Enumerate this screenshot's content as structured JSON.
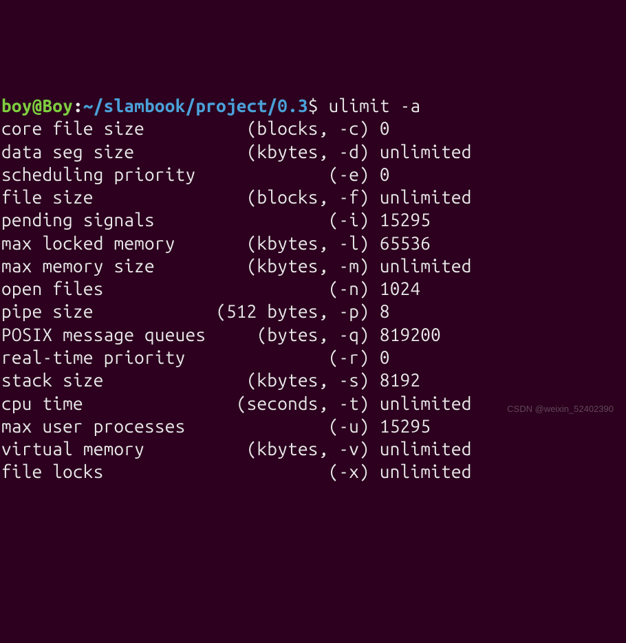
{
  "prompt": {
    "user": "boy@Boy",
    "colon": ":",
    "path": "~/slambook/project/0.3",
    "dollar": "$ ",
    "command": "ulimit -a"
  },
  "rows": [
    {
      "name": "core file size          ",
      "spec": "(blocks, -c) ",
      "val": "0"
    },
    {
      "name": "data seg size           ",
      "spec": "(kbytes, -d) ",
      "val": "unlimited"
    },
    {
      "name": "scheduling priority     ",
      "spec": "        (-e) ",
      "val": "0"
    },
    {
      "name": "file size               ",
      "spec": "(blocks, -f) ",
      "val": "unlimited"
    },
    {
      "name": "pending signals         ",
      "spec": "        (-i) ",
      "val": "15295"
    },
    {
      "name": "max locked memory       ",
      "spec": "(kbytes, -l) ",
      "val": "65536"
    },
    {
      "name": "max memory size         ",
      "spec": "(kbytes, -m) ",
      "val": "unlimited"
    },
    {
      "name": "open files              ",
      "spec": "        (-n) ",
      "val": "1024"
    },
    {
      "name": "pipe size            ",
      "spec": "(512 bytes, -p) ",
      "val": "8"
    },
    {
      "name": "POSIX message queues     ",
      "spec": "(bytes, -q) ",
      "val": "819200"
    },
    {
      "name": "real-time priority      ",
      "spec": "        (-r) ",
      "val": "0"
    },
    {
      "name": "stack size              ",
      "spec": "(kbytes, -s) ",
      "val": "8192"
    },
    {
      "name": "cpu time               ",
      "spec": "(seconds, -t) ",
      "val": "unlimited"
    },
    {
      "name": "max user processes      ",
      "spec": "        (-u) ",
      "val": "15295"
    },
    {
      "name": "virtual memory          ",
      "spec": "(kbytes, -v) ",
      "val": "unlimited"
    },
    {
      "name": "file locks              ",
      "spec": "        (-x) ",
      "val": "unlimited"
    }
  ],
  "watermark": "CSDN @weixin_52402390"
}
